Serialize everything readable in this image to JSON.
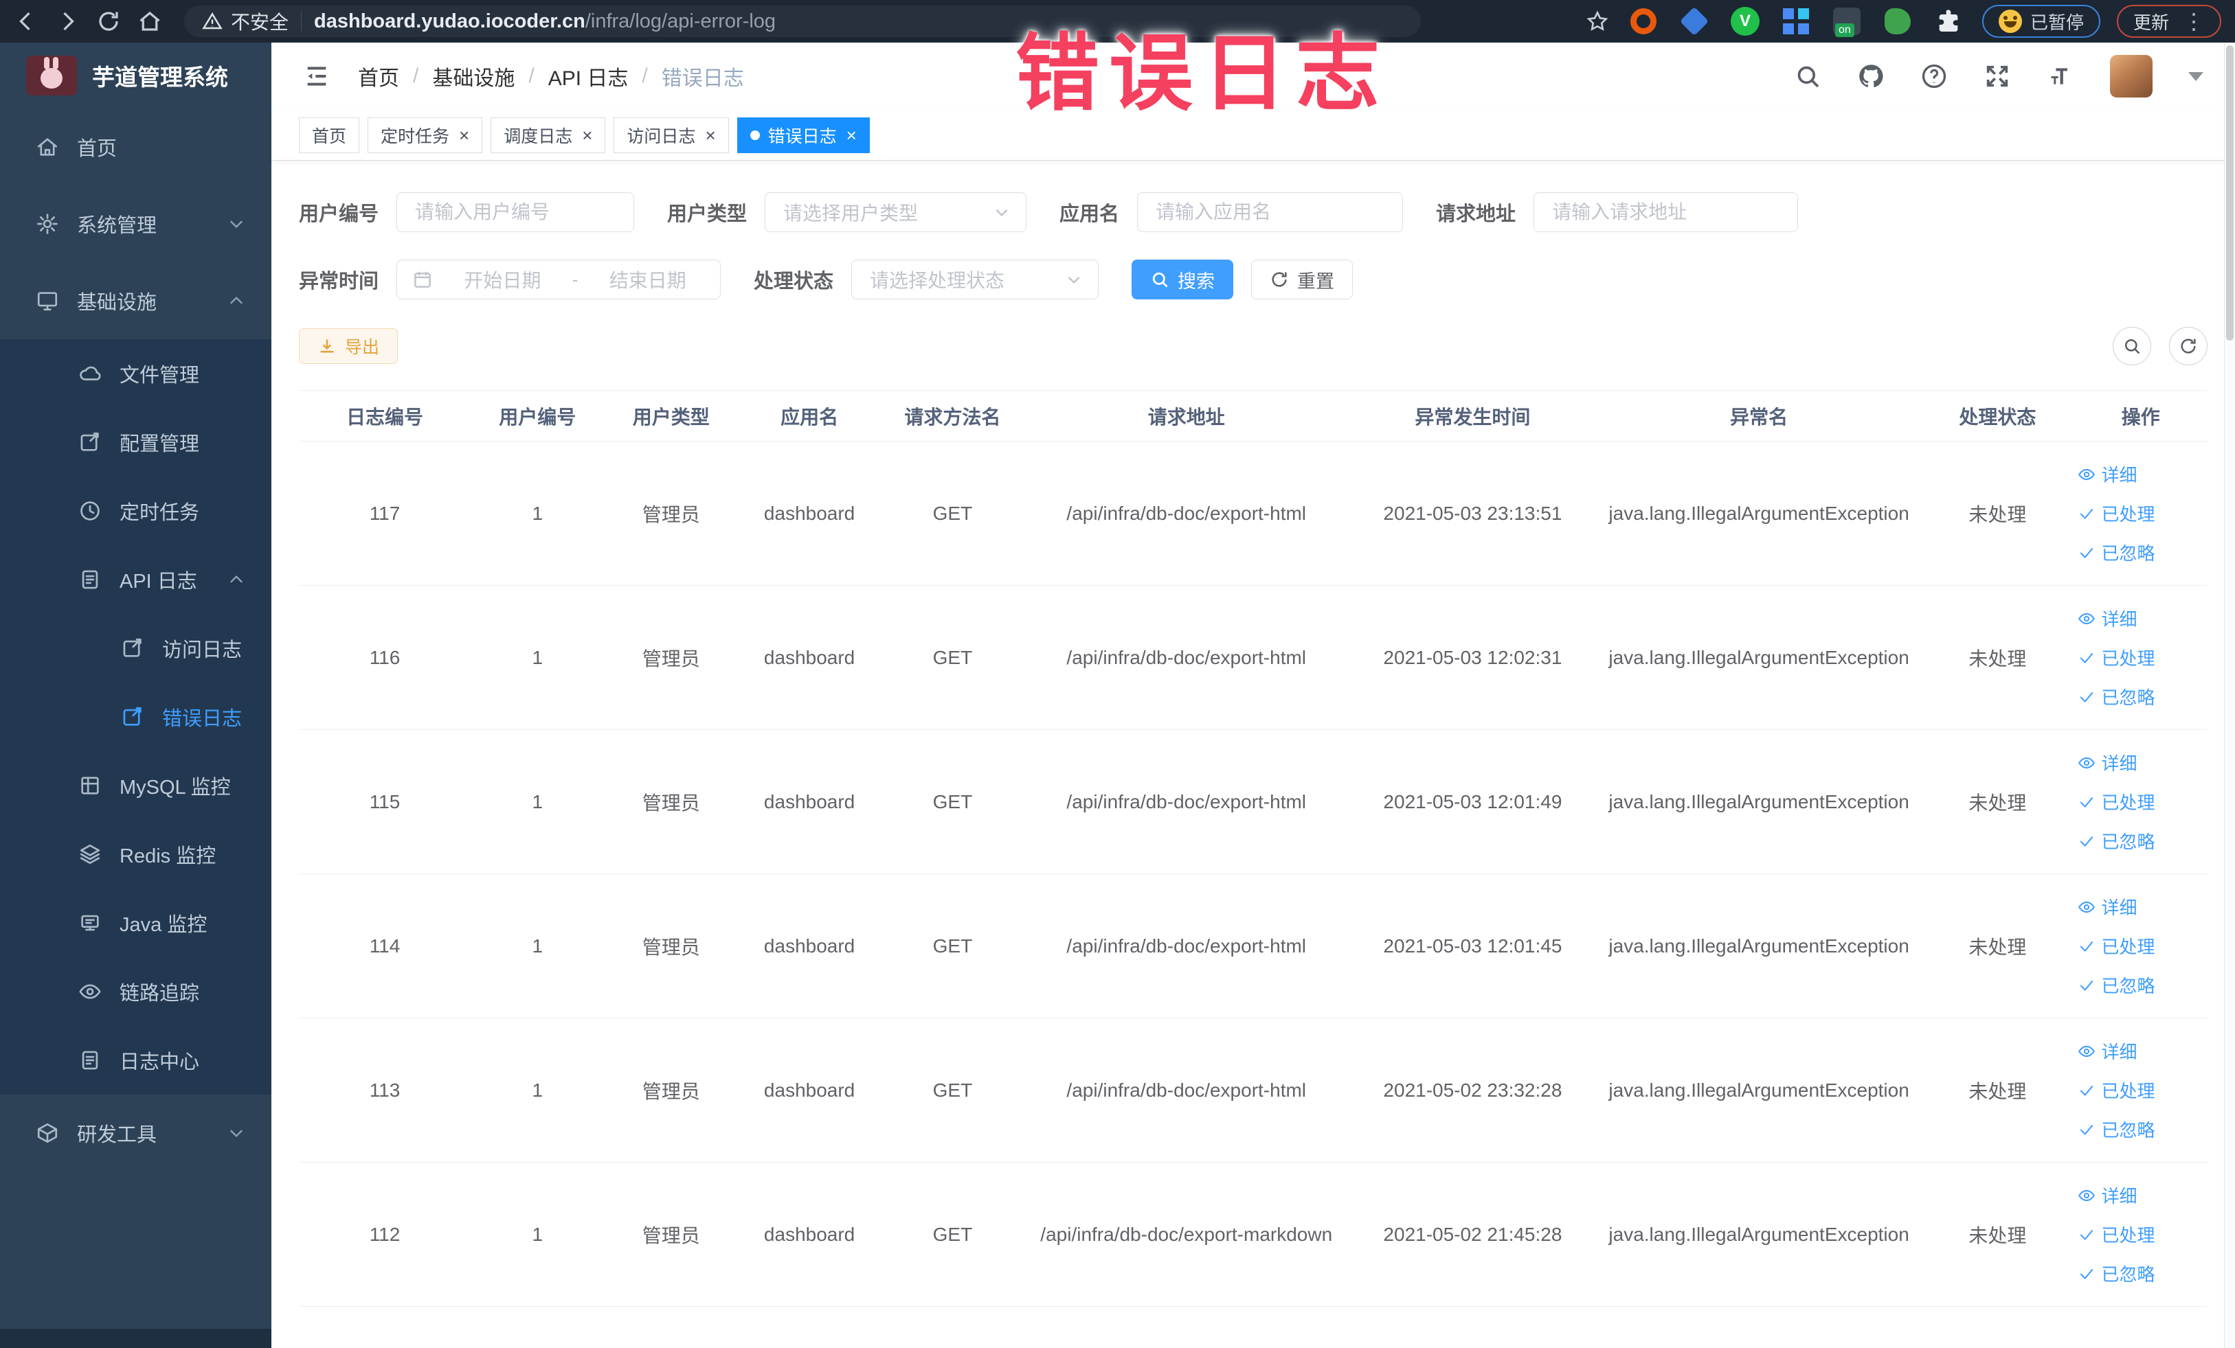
{
  "browser": {
    "security_label": "不安全",
    "url_host": "dashboard.yudao.iocoder.cn",
    "url_path": "/infra/log/api-error-log",
    "paused_label": "已暂停",
    "update_label": "更新",
    "kebab": "⋮"
  },
  "watermark": "错误日志",
  "sidebar": {
    "title": "芋道管理系统",
    "items": [
      {
        "label": "首页",
        "icon": "home-icon",
        "level": 1
      },
      {
        "label": "系统管理",
        "icon": "gear-icon",
        "level": 1,
        "arrow": "down"
      },
      {
        "label": "基础设施",
        "icon": "monitor-icon",
        "level": 1,
        "arrow": "up"
      },
      {
        "label": "文件管理",
        "icon": "cloud-icon",
        "level": 2
      },
      {
        "label": "配置管理",
        "icon": "edit-icon",
        "level": 2
      },
      {
        "label": "定时任务",
        "icon": "clock-icon",
        "level": 2
      },
      {
        "label": "API 日志",
        "icon": "doc-icon",
        "level": 2,
        "arrow": "up"
      },
      {
        "label": "访问日志",
        "icon": "edit-icon",
        "level": 3
      },
      {
        "label": "错误日志",
        "icon": "edit-icon",
        "level": 3,
        "active": true
      },
      {
        "label": "MySQL 监控",
        "icon": "grid-icon",
        "level": 2
      },
      {
        "label": "Redis 监控",
        "icon": "layers-icon",
        "level": 2
      },
      {
        "label": "Java 监控",
        "icon": "java-monitor-icon",
        "level": 2
      },
      {
        "label": "链路追踪",
        "icon": "eye-icon",
        "level": 2
      },
      {
        "label": "日志中心",
        "icon": "doc-icon",
        "level": 2
      },
      {
        "label": "研发工具",
        "icon": "box-icon",
        "level": 1,
        "arrow": "down"
      }
    ]
  },
  "header": {
    "breadcrumbs": [
      "首页",
      "基础设施",
      "API 日志",
      "错误日志"
    ]
  },
  "tabs": [
    {
      "label": "首页",
      "active": false,
      "closable": false
    },
    {
      "label": "定时任务",
      "active": false,
      "closable": true
    },
    {
      "label": "调度日志",
      "active": false,
      "closable": true
    },
    {
      "label": "访问日志",
      "active": false,
      "closable": true
    },
    {
      "label": "错误日志",
      "active": true,
      "closable": true
    }
  ],
  "filters": {
    "fields": [
      {
        "label": "用户编号",
        "placeholder": "请输入用户编号"
      },
      {
        "label": "用户类型",
        "placeholder": "请选择用户类型"
      },
      {
        "label": "应用名",
        "placeholder": "请输入应用名"
      },
      {
        "label": "请求地址",
        "placeholder": "请输入请求地址"
      },
      {
        "label": "异常时间",
        "start_placeholder": "开始日期",
        "separator": "-",
        "end_placeholder": "结束日期"
      },
      {
        "label": "处理状态",
        "placeholder": "请选择处理状态"
      }
    ],
    "search_label": "搜索",
    "reset_label": "重置"
  },
  "toolbar": {
    "export_label": "导出"
  },
  "table": {
    "columns": [
      "日志编号",
      "用户编号",
      "用户类型",
      "应用名",
      "请求方法名",
      "请求地址",
      "异常发生时间",
      "异常名",
      "处理状态",
      "操作"
    ],
    "col_widths": [
      "9%",
      "7%",
      "7%",
      "7.5%",
      "7.5%",
      "17%",
      "13%",
      "17%",
      "8%",
      "7%"
    ],
    "rows": [
      {
        "id": "117",
        "user_id": "1",
        "user_type": "管理员",
        "app": "dashboard",
        "method": "GET",
        "url": "/api/infra/db-doc/export-html",
        "time": "2021-05-03 23:13:51",
        "exception": "java.lang.IllegalArgumentException",
        "status": "未处理"
      },
      {
        "id": "116",
        "user_id": "1",
        "user_type": "管理员",
        "app": "dashboard",
        "method": "GET",
        "url": "/api/infra/db-doc/export-html",
        "time": "2021-05-03 12:02:31",
        "exception": "java.lang.IllegalArgumentException",
        "status": "未处理"
      },
      {
        "id": "115",
        "user_id": "1",
        "user_type": "管理员",
        "app": "dashboard",
        "method": "GET",
        "url": "/api/infra/db-doc/export-html",
        "time": "2021-05-03 12:01:49",
        "exception": "java.lang.IllegalArgumentException",
        "status": "未处理"
      },
      {
        "id": "114",
        "user_id": "1",
        "user_type": "管理员",
        "app": "dashboard",
        "method": "GET",
        "url": "/api/infra/db-doc/export-html",
        "time": "2021-05-03 12:01:45",
        "exception": "java.lang.IllegalArgumentException",
        "status": "未处理"
      },
      {
        "id": "113",
        "user_id": "1",
        "user_type": "管理员",
        "app": "dashboard",
        "method": "GET",
        "url": "/api/infra/db-doc/export-html",
        "time": "2021-05-02 23:32:28",
        "exception": "java.lang.IllegalArgumentException",
        "status": "未处理"
      },
      {
        "id": "112",
        "user_id": "1",
        "user_type": "管理员",
        "app": "dashboard",
        "method": "GET",
        "url": "/api/infra/db-doc/export-markdown",
        "time": "2021-05-02 21:45:28",
        "exception": "java.lang.IllegalArgumentException",
        "status": "未处理"
      }
    ],
    "actions": [
      "详细",
      "已处理",
      "已忽略"
    ]
  },
  "colors": {
    "accent": "#409eff",
    "tab_active": "#1890ff",
    "warning": "#e6a23c",
    "watermark": "#f5405f",
    "sidebar_bg": "#2d4257",
    "sidebar_submenu_bg": "#223850"
  }
}
